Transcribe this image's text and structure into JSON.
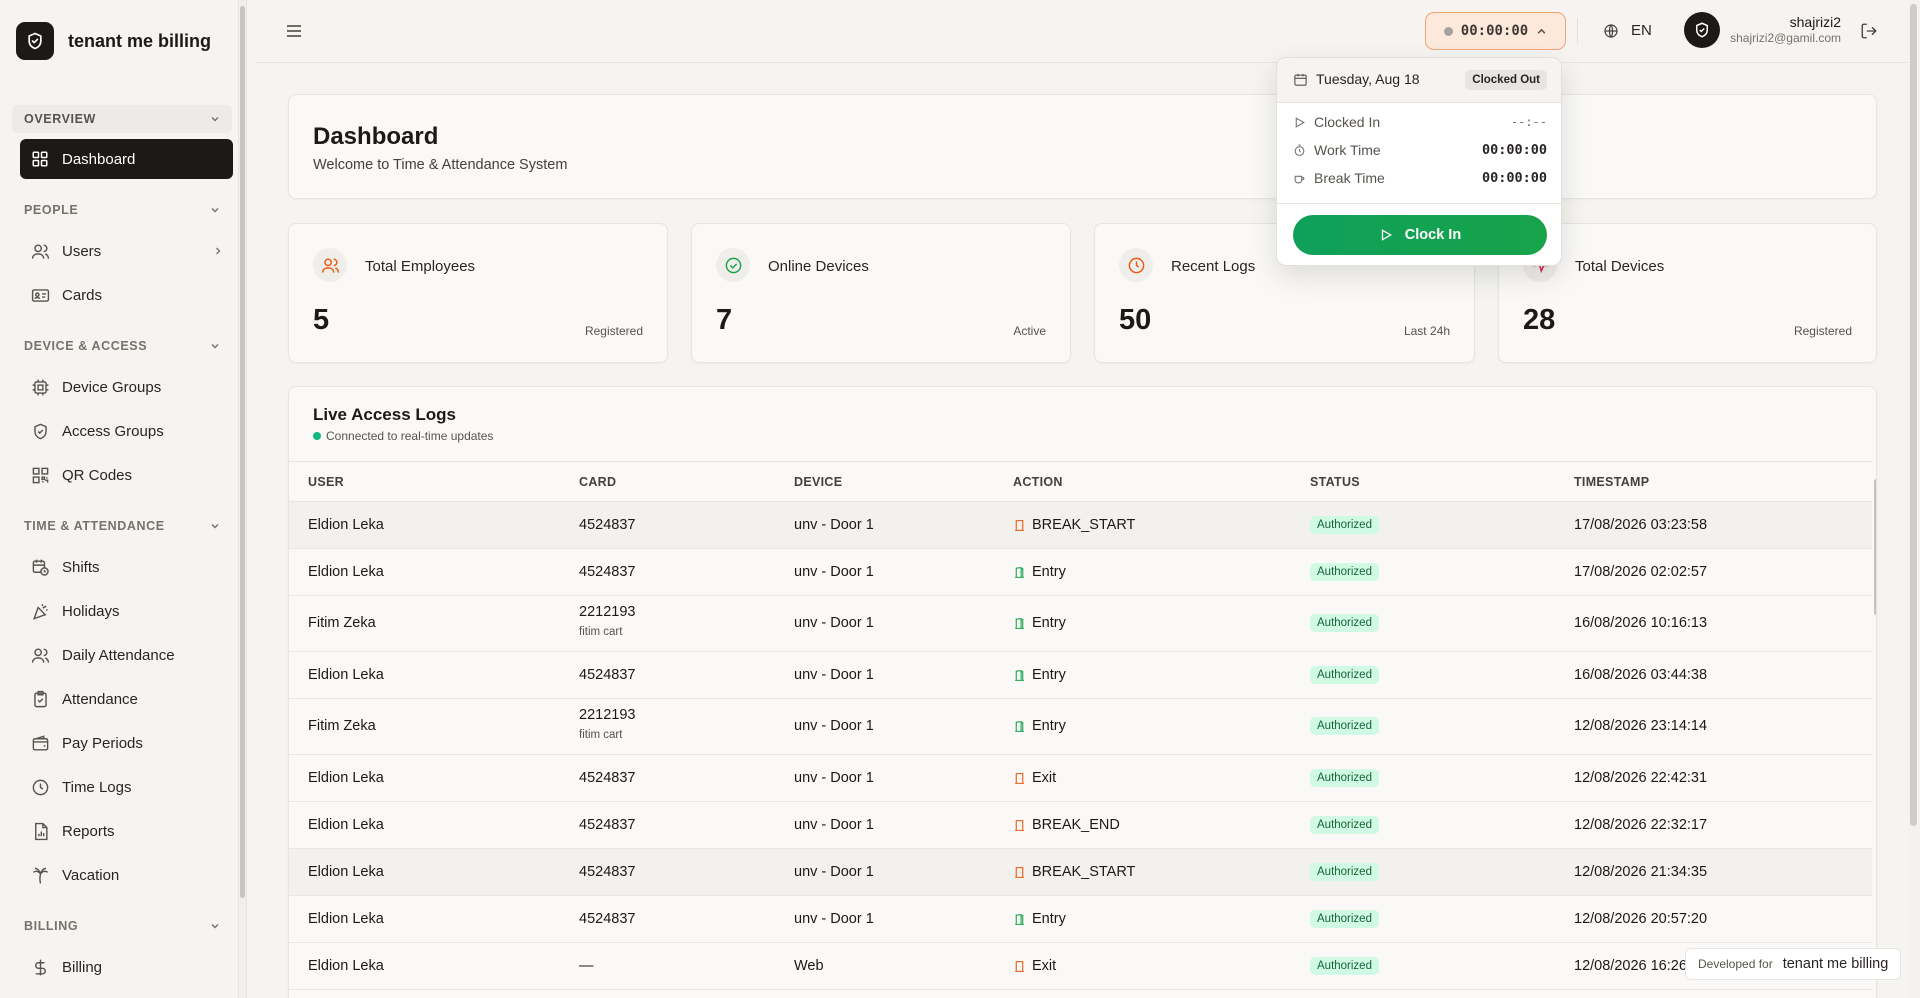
{
  "app": {
    "name": "tenant me billing"
  },
  "sidebar": {
    "groups": [
      {
        "label": "OVERVIEW",
        "items": [
          {
            "label": "Dashboard",
            "icon": "grid-icon",
            "active": true
          }
        ]
      },
      {
        "label": "PEOPLE",
        "items": [
          {
            "label": "Users",
            "icon": "users-icon"
          },
          {
            "label": "Cards",
            "icon": "id-card-icon"
          }
        ]
      },
      {
        "label": "DEVICE & ACCESS",
        "items": [
          {
            "label": "Device Groups",
            "icon": "cpu-icon"
          },
          {
            "label": "Access Groups",
            "icon": "shield-icon"
          },
          {
            "label": "QR Codes",
            "icon": "qr-code-icon"
          }
        ]
      },
      {
        "label": "TIME & ATTENDANCE",
        "items": [
          {
            "label": "Shifts",
            "icon": "calendar-clock-icon"
          },
          {
            "label": "Holidays",
            "icon": "party-popper-icon"
          },
          {
            "label": "Daily Attendance",
            "icon": "users-icon"
          },
          {
            "label": "Attendance",
            "icon": "clipboard-check-icon"
          },
          {
            "label": "Pay Periods",
            "icon": "wallet-icon"
          },
          {
            "label": "Time Logs",
            "icon": "clock-icon"
          },
          {
            "label": "Reports",
            "icon": "file-chart-icon"
          },
          {
            "label": "Vacation",
            "icon": "palm-tree-icon"
          }
        ]
      },
      {
        "label": "BILLING",
        "items": [
          {
            "label": "Billing",
            "icon": "dollar-icon"
          }
        ]
      }
    ]
  },
  "topbar": {
    "timer": "00:00:00",
    "language": "EN",
    "user": {
      "name": "shajrizi2",
      "email": "shajrizi2@gamil.com"
    }
  },
  "dashboard": {
    "title": "Dashboard",
    "subtitle": "Welcome to Time & Attendance System",
    "stats": [
      {
        "label": "Total Employees",
        "value": "5",
        "note": "Registered",
        "icon": "users-icon",
        "color": "#ea580c"
      },
      {
        "label": "Online Devices",
        "value": "7",
        "note": "Active",
        "icon": "check-circle-icon",
        "color": "#16a34a"
      },
      {
        "label": "Recent Logs",
        "value": "50",
        "note": "Last 24h",
        "icon": "clock-icon",
        "color": "#ea580c"
      },
      {
        "label": "Total Devices",
        "value": "28",
        "note": "Registered",
        "icon": "pulse-icon",
        "color": "#e11d48"
      }
    ]
  },
  "logs": {
    "title": "Live Access Logs",
    "subtitle": "Connected to real-time updates",
    "columns": [
      "USER",
      "CARD",
      "DEVICE",
      "ACTION",
      "STATUS",
      "TIMESTAMP"
    ],
    "rows": [
      {
        "user": "Eldion Leka",
        "card": "4524837",
        "card_note": "",
        "device": "unv - Door 1",
        "action": "BREAK_START",
        "action_icon": "door-icon-orange",
        "status": "Authorized",
        "timestamp": "17/08/2026 03:23:58"
      },
      {
        "user": "Eldion Leka",
        "card": "4524837",
        "card_note": "",
        "device": "unv - Door 1",
        "action": "Entry",
        "action_icon": "door-icon-green",
        "status": "Authorized",
        "timestamp": "17/08/2026 02:02:57"
      },
      {
        "user": "Fitim Zeka",
        "card": "2212193",
        "card_note": "fitim cart",
        "device": "unv - Door 1",
        "action": "Entry",
        "action_icon": "door-icon-green",
        "status": "Authorized",
        "timestamp": "16/08/2026 10:16:13"
      },
      {
        "user": "Eldion Leka",
        "card": "4524837",
        "card_note": "",
        "device": "unv - Door 1",
        "action": "Entry",
        "action_icon": "door-icon-green",
        "status": "Authorized",
        "timestamp": "16/08/2026 03:44:38"
      },
      {
        "user": "Fitim Zeka",
        "card": "2212193",
        "card_note": "fitim cart",
        "device": "unv - Door 1",
        "action": "Entry",
        "action_icon": "door-icon-green",
        "status": "Authorized",
        "timestamp": "12/08/2026 23:14:14"
      },
      {
        "user": "Eldion Leka",
        "card": "4524837",
        "card_note": "",
        "device": "unv - Door 1",
        "action": "Exit",
        "action_icon": "door-icon-orange",
        "status": "Authorized",
        "timestamp": "12/08/2026 22:42:31"
      },
      {
        "user": "Eldion Leka",
        "card": "4524837",
        "card_note": "",
        "device": "unv - Door 1",
        "action": "BREAK_END",
        "action_icon": "door-icon-orange",
        "status": "Authorized",
        "timestamp": "12/08/2026 22:32:17"
      },
      {
        "user": "Eldion Leka",
        "card": "4524837",
        "card_note": "",
        "device": "unv - Door 1",
        "action": "BREAK_START",
        "action_icon": "door-icon-orange",
        "status": "Authorized",
        "timestamp": "12/08/2026 21:34:35"
      },
      {
        "user": "Eldion Leka",
        "card": "4524837",
        "card_note": "",
        "device": "unv - Door 1",
        "action": "Entry",
        "action_icon": "door-icon-green",
        "status": "Authorized",
        "timestamp": "12/08/2026 20:57:20"
      },
      {
        "user": "Eldion Leka",
        "card": "—",
        "card_note": "",
        "device": "Web",
        "action": "Exit",
        "action_icon": "door-icon-orange",
        "status": "Authorized",
        "timestamp": "12/08/2026 16:26:23"
      }
    ]
  },
  "clock_popover": {
    "date": "Tuesday, Aug 18",
    "status": "Clocked Out",
    "clocked_in_label": "Clocked In",
    "clocked_in_value": "--:--",
    "work_time_label": "Work Time",
    "work_time_value": "00:00:00",
    "break_time_label": "Break Time",
    "break_time_value": "00:00:00",
    "button_label": "Clock In"
  },
  "footer": {
    "developed_for": "Developed for",
    "tenant": "tenant me billing"
  },
  "colors": {
    "accent": "#1c1917",
    "success": "#16a34a",
    "timer_border": "#f2a477"
  }
}
